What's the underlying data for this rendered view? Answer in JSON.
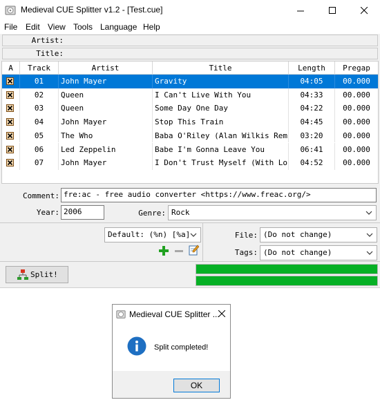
{
  "window": {
    "title": "Medieval CUE Splitter v1.2 - [Test.cue]"
  },
  "menu": [
    "File",
    "Edit",
    "View",
    "Tools",
    "Language",
    "Help"
  ],
  "header": {
    "artist_label": "Artist:",
    "title_label": "Title:"
  },
  "table": {
    "columns": [
      "A",
      "Track",
      "Artist",
      "Title",
      "Length",
      "Pregap"
    ],
    "rows": [
      {
        "track": "01",
        "artist": "John Mayer",
        "title": "Gravity",
        "length": "04:05",
        "pregap": "00.000",
        "selected": true
      },
      {
        "track": "02",
        "artist": "Queen",
        "title": "I Can't Live With You",
        "length": "04:33",
        "pregap": "00.000"
      },
      {
        "track": "03",
        "artist": "Queen",
        "title": "Some Day One Day",
        "length": "04:22",
        "pregap": "00.000"
      },
      {
        "track": "04",
        "artist": "John Mayer",
        "title": "Stop This Train",
        "length": "04:45",
        "pregap": "00.000"
      },
      {
        "track": "05",
        "artist": "The Who",
        "title": "Baba O'Riley (Alan Wilkis Rem",
        "length": "03:20",
        "pregap": "00.000"
      },
      {
        "track": "06",
        "artist": "Led Zeppelin",
        "title": "Babe I'm Gonna Leave You",
        "length": "06:41",
        "pregap": "00.000"
      },
      {
        "track": "07",
        "artist": "John Mayer",
        "title": "I Don't Trust Myself (With Lo",
        "length": "04:52",
        "pregap": "00.000"
      }
    ]
  },
  "meta": {
    "comment_label": "Comment:",
    "comment_value": "fre:ac - free audio converter <https://www.freac.org/>",
    "year_label": "Year:",
    "year_value": "2006",
    "genre_label": "Genre:",
    "genre_value": "Rock"
  },
  "output": {
    "pattern_value": "Default: (%n) [%a]",
    "file_label": "File:",
    "file_value": "(Do not change)",
    "tags_label": "Tags:",
    "tags_value": "(Do not change)"
  },
  "actions": {
    "split_label": "Split!",
    "progress": [
      1.0,
      1.0
    ]
  },
  "dialog": {
    "title": "Medieval CUE Splitter ...",
    "message": "Split completed!",
    "ok_label": "OK"
  },
  "colors": {
    "selection": "#0078d7",
    "progress": "#06b025",
    "info": "#1e6fc2"
  }
}
